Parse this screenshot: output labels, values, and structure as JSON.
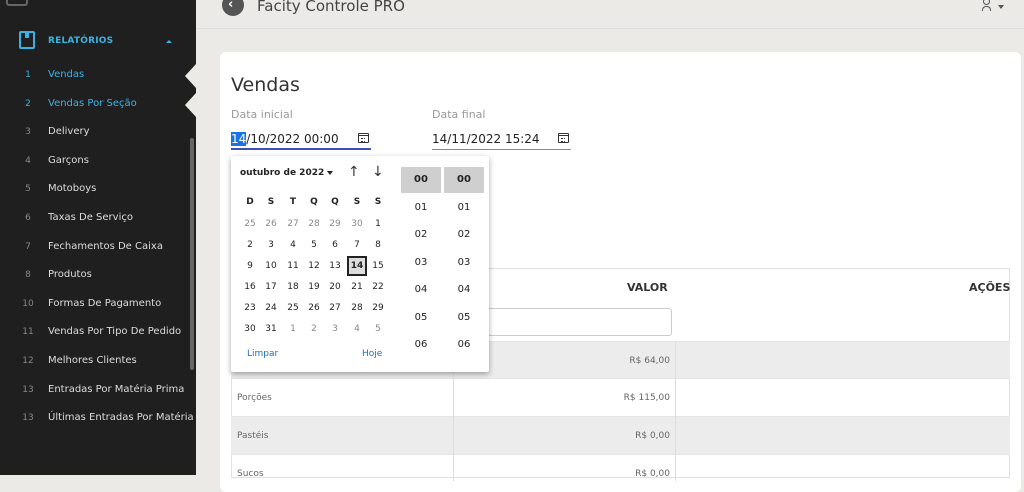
{
  "app": {
    "title": "Facity Controle PRO"
  },
  "sidebar": {
    "section_label": "RELATÓRIOS",
    "items": [
      {
        "num": "1",
        "label": "Vendas",
        "active": true
      },
      {
        "num": "2",
        "label": "Vendas Por Seção",
        "active": true
      },
      {
        "num": "3",
        "label": "Delivery"
      },
      {
        "num": "4",
        "label": "Garçons"
      },
      {
        "num": "5",
        "label": "Motoboys"
      },
      {
        "num": "6",
        "label": "Taxas De Serviço"
      },
      {
        "num": "7",
        "label": "Fechamentos De Caixa"
      },
      {
        "num": "8",
        "label": "Produtos"
      },
      {
        "num": "10",
        "label": "Formas De Pagamento"
      },
      {
        "num": "11",
        "label": "Vendas Por Tipo De Pedido"
      },
      {
        "num": "12",
        "label": "Melhores Clientes"
      },
      {
        "num": "13",
        "label": "Entradas Por Matéria Prima"
      },
      {
        "num": "13",
        "label": "Últimas Entradas Por Matéria Pr"
      }
    ]
  },
  "page": {
    "title": "Vendas",
    "start_label": "Data inicial",
    "start_day": "14",
    "start_rest": "/10/2022 00:00",
    "end_label": "Data final",
    "end_value": "14/11/2022 15:24"
  },
  "table": {
    "headers": {
      "valor": "VALOR",
      "acoes": "AÇÕES"
    },
    "rows": [
      {
        "name": "",
        "value": "R$ 64,00"
      },
      {
        "name": "Porções",
        "value": "R$ 115,00"
      },
      {
        "name": "Pastéis",
        "value": "R$ 0,00"
      },
      {
        "name": "Sucos",
        "value": "R$ 0,00"
      }
    ]
  },
  "datepicker": {
    "month_label": "outubro de 2022",
    "weekdays": [
      "D",
      "S",
      "T",
      "Q",
      "Q",
      "S",
      "S"
    ],
    "weeks": [
      [
        "25",
        "26",
        "27",
        "28",
        "29",
        "30",
        "1"
      ],
      [
        "2",
        "3",
        "4",
        "5",
        "6",
        "7",
        "8"
      ],
      [
        "9",
        "10",
        "11",
        "12",
        "13",
        "14",
        "15"
      ],
      [
        "16",
        "17",
        "18",
        "19",
        "20",
        "21",
        "22"
      ],
      [
        "23",
        "24",
        "25",
        "26",
        "27",
        "28",
        "29"
      ],
      [
        "30",
        "31",
        "1",
        "2",
        "3",
        "4",
        "5"
      ]
    ],
    "selected_day": "14",
    "clear_label": "Limpar",
    "today_label": "Hoje",
    "hours": [
      "00",
      "01",
      "02",
      "03",
      "04",
      "05",
      "06"
    ],
    "minutes": [
      "00",
      "01",
      "02",
      "03",
      "04",
      "05",
      "06"
    ],
    "selected_hour": "00",
    "selected_minute": "00"
  }
}
